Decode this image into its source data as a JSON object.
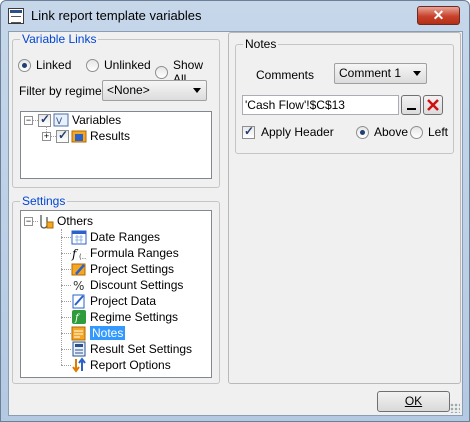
{
  "window": {
    "title": "Link report template variables",
    "close_symbol": "✕"
  },
  "variable_links": {
    "title": "Variable Links",
    "radios": [
      {
        "label": "Linked",
        "selected": true
      },
      {
        "label": "Unlinked",
        "selected": false
      },
      {
        "label": "Show All",
        "selected": false
      }
    ],
    "filter_label": "Filter by regime:",
    "filter_value": "<None>",
    "tree": [
      {
        "label": "Variables",
        "checked": true,
        "expander": "−"
      },
      {
        "label": "Results",
        "checked": true,
        "expander": "+"
      }
    ]
  },
  "settings": {
    "title": "Settings",
    "root": {
      "label": "Others",
      "expander": "−"
    },
    "items": [
      {
        "label": "Date Ranges",
        "icon": "calendar-icon"
      },
      {
        "label": "Formula Ranges",
        "icon": "function-icon"
      },
      {
        "label": "Project Settings",
        "icon": "project-settings-icon"
      },
      {
        "label": "Discount Settings",
        "icon": "percent-icon"
      },
      {
        "label": "Project Data",
        "icon": "project-data-icon"
      },
      {
        "label": "Regime Settings",
        "icon": "regime-icon"
      },
      {
        "label": "Notes",
        "icon": "notes-icon",
        "selected": true
      },
      {
        "label": "Result Set Settings",
        "icon": "result-set-icon"
      },
      {
        "label": "Report Options",
        "icon": "report-options-icon"
      }
    ]
  },
  "notes": {
    "title": "Notes",
    "comments_label": "Comments",
    "comments_value": "Comment 1",
    "cell_ref": "'Cash Flow'!$C$13",
    "apply_header_label": "Apply Header",
    "apply_header_checked": true,
    "position_options": [
      {
        "label": "Above",
        "selected": true
      },
      {
        "label": "Left",
        "selected": false
      }
    ]
  },
  "buttons": {
    "ok": "OK"
  },
  "colors": {
    "accent": "#0046d5",
    "selection": "#3399ff",
    "close": "#c7412b"
  }
}
